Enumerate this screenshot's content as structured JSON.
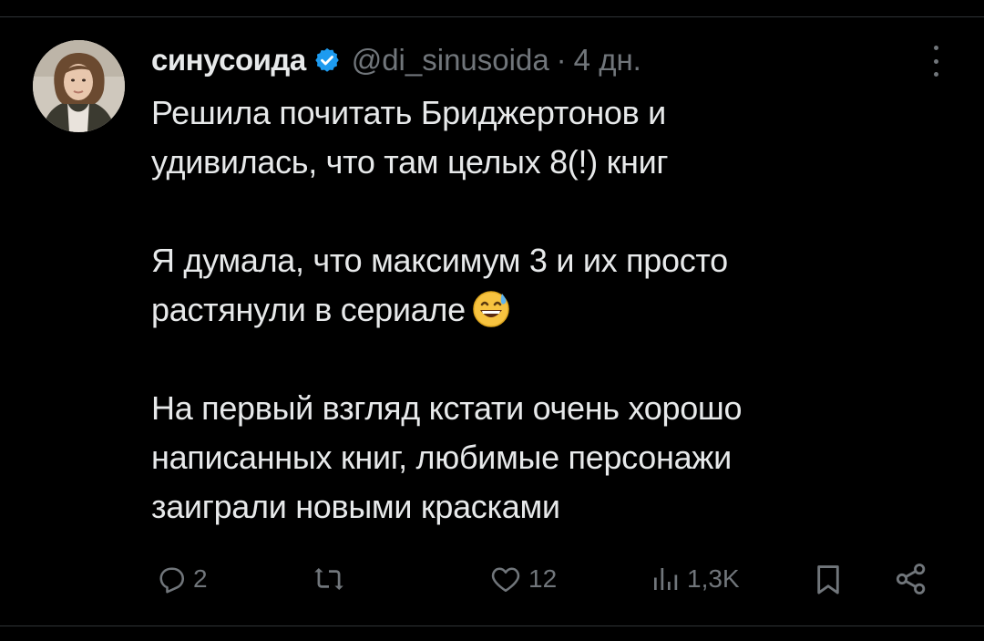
{
  "author": {
    "display_name": "синусоида",
    "handle": "@di_sinusoida",
    "separator": "·",
    "time": "4 дн.",
    "verified_icon": "verified-badge-icon",
    "avatar": "user-avatar-photo"
  },
  "tweet": {
    "line1": "Решила почитать Бриджертонов и",
    "line2": "удивилась, что там целых 8(!) книг",
    "line3": "Я думала, что максимум 3 и их просто",
    "line4": "растянули в сериале",
    "line4_emoji": "grinning-face-with-sweat-emoji",
    "line5": "На первый взгляд кстати очень хорошо",
    "line6": "написанных книг, любимые персонажи",
    "line7": "заиграли новыми красками"
  },
  "actions": {
    "replies": "2",
    "retweets": "",
    "likes": "12",
    "views": "1,3K"
  },
  "colors": {
    "background": "#000000",
    "text": "#e7e9ea",
    "secondary": "#71767b",
    "verified": "#1d9bf0",
    "divider": "#2f3336"
  }
}
